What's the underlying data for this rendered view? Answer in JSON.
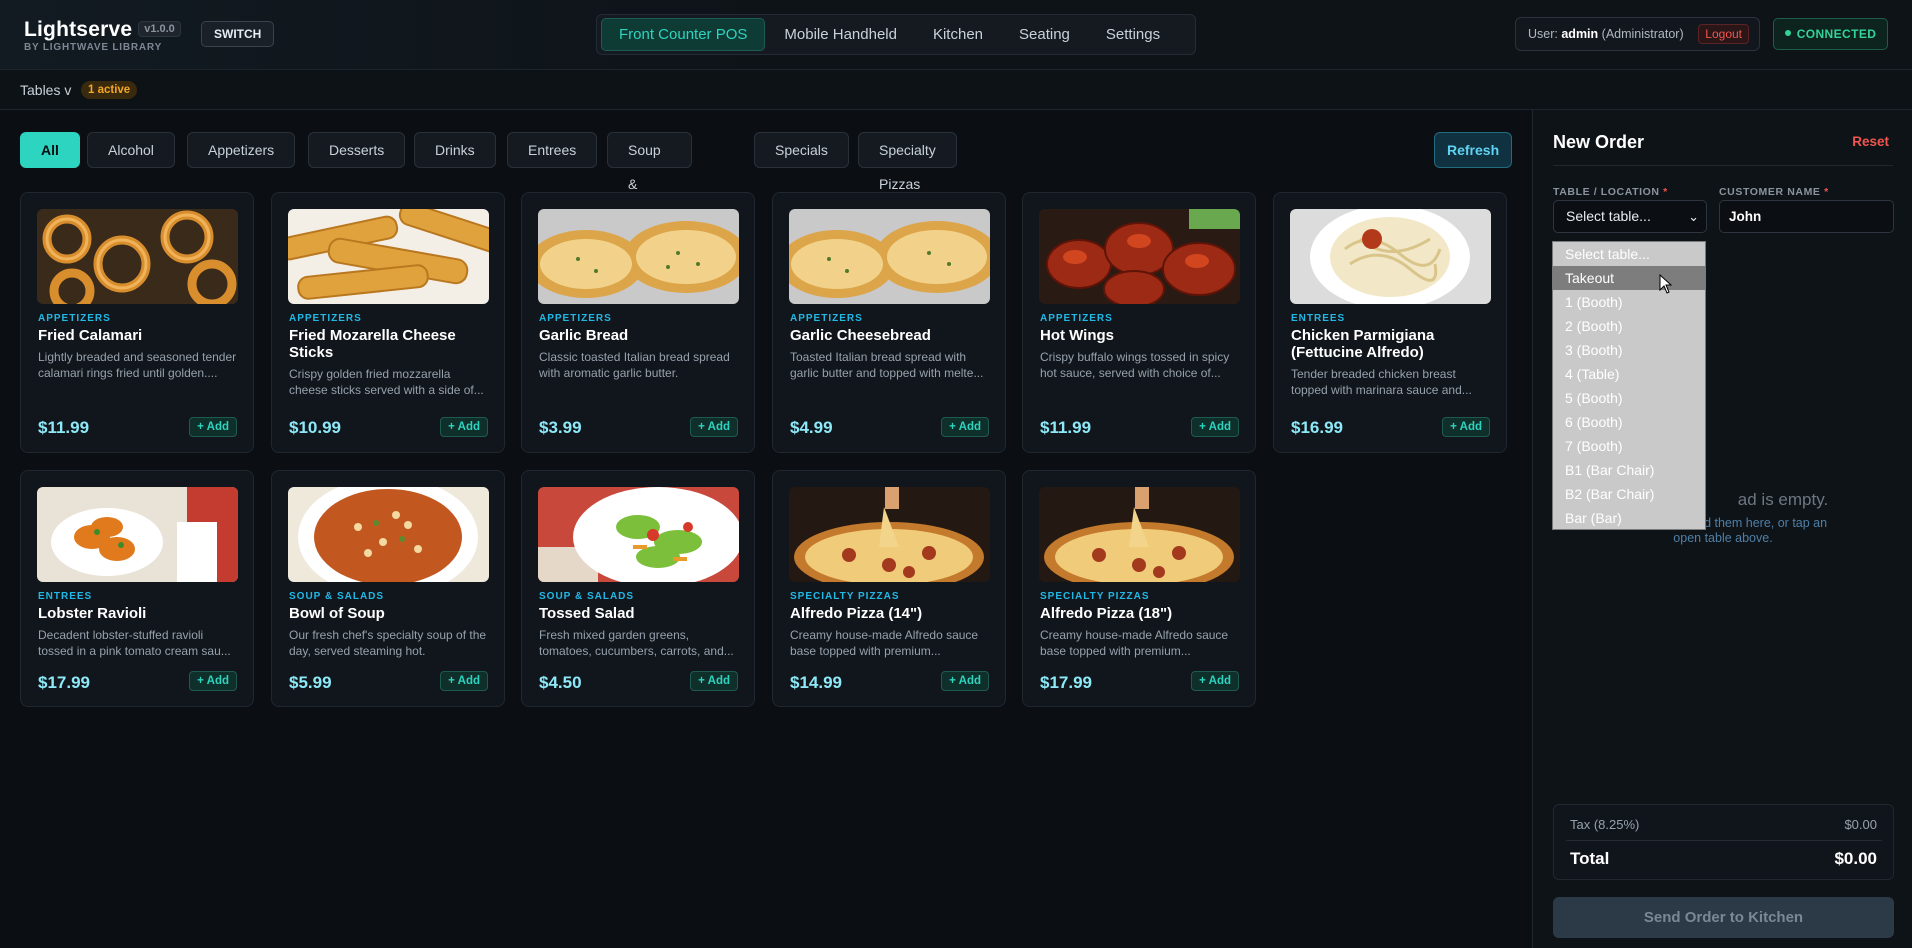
{
  "brand": {
    "name": "Lightserve",
    "version": "v1.0.0",
    "subtitle": "BY LIGHTWAVE LIBRARY",
    "switch_label": "SWITCH"
  },
  "nav": {
    "items": [
      {
        "label": "Front Counter POS",
        "active": true
      },
      {
        "label": "Mobile Handheld",
        "active": false
      },
      {
        "label": "Kitchen",
        "active": false
      },
      {
        "label": "Seating",
        "active": false
      },
      {
        "label": "Settings",
        "active": false
      }
    ]
  },
  "user": {
    "prefix": "User:",
    "name": "admin",
    "role": "(Administrator)",
    "logout_label": "Logout"
  },
  "connection": {
    "status": "CONNECTED",
    "color": "#34d399"
  },
  "subbar": {
    "tables_label": "Tables v",
    "active_badge": "1 active"
  },
  "filters": {
    "items": [
      "All",
      "Alcohol",
      "Appetizers",
      "Desserts",
      "Drinks",
      "Entrees",
      "Soup & Salads",
      "Specials",
      "Specialty Pizzas"
    ],
    "selected": "All",
    "refresh_label": "Refresh"
  },
  "products": [
    {
      "category": "APPETIZERS",
      "name": "Fried Calamari",
      "description": "Lightly breaded and seasoned tender calamari rings fried until golden....",
      "price": "$11.99",
      "add_label": "+ Add",
      "image": "calamari"
    },
    {
      "category": "APPETIZERS",
      "name": "Fried Mozarella Cheese Sticks",
      "description": "Crispy golden fried mozzarella cheese sticks served with a side of...",
      "price": "$10.99",
      "add_label": "+ Add",
      "image": "mozzarella-sticks"
    },
    {
      "category": "APPETIZERS",
      "name": "Garlic Bread",
      "description": "Classic toasted Italian bread spread with aromatic garlic butter.",
      "price": "$3.99",
      "add_label": "+ Add",
      "image": "garlic-bread"
    },
    {
      "category": "APPETIZERS",
      "name": "Garlic Cheesebread",
      "description": "Toasted Italian bread spread with garlic butter and topped with melte...",
      "price": "$4.99",
      "add_label": "+ Add",
      "image": "garlic-bread"
    },
    {
      "category": "APPETIZERS",
      "name": "Hot Wings",
      "description": "Crispy buffalo wings tossed in spicy hot sauce, served with choice of...",
      "price": "$11.99",
      "add_label": "+ Add",
      "image": "hot-wings"
    },
    {
      "category": "ENTREES",
      "name": "Chicken Parmigiana (Fettucine Alfredo)",
      "description": "Tender breaded chicken breast topped with marinara sauce and...",
      "price": "$16.99",
      "add_label": "+ Add",
      "image": "pasta-plate"
    },
    {
      "category": "ENTREES",
      "name": "Lobster Ravioli",
      "description": "Decadent lobster-stuffed ravioli tossed in a pink tomato cream sau...",
      "price": "$17.99",
      "add_label": "+ Add",
      "image": "ravioli"
    },
    {
      "category": "SOUP & SALADS",
      "name": "Bowl of Soup",
      "description": "Our fresh chef's specialty soup of the day, served steaming hot.",
      "price": "$5.99",
      "add_label": "+ Add",
      "image": "soup"
    },
    {
      "category": "SOUP & SALADS",
      "name": "Tossed Salad",
      "description": "Fresh mixed garden greens, tomatoes, cucumbers, carrots, and...",
      "price": "$4.50",
      "add_label": "+ Add",
      "image": "salad"
    },
    {
      "category": "SPECIALTY PIZZAS",
      "name": "Alfredo Pizza (14\")",
      "description": "Creamy house-made Alfredo sauce base topped with premium...",
      "price": "$14.99",
      "add_label": "+ Add",
      "image": "pizza"
    },
    {
      "category": "SPECIALTY PIZZAS",
      "name": "Alfredo Pizza (18\")",
      "description": "Creamy house-made Alfredo sauce base topped with premium...",
      "price": "$17.99",
      "add_label": "+ Add",
      "image": "pizza"
    }
  ],
  "order": {
    "title": "New Order",
    "reset_label": "Reset",
    "table_label": "TABLE / LOCATION",
    "customer_label": "CUSTOMER NAME",
    "required_mark": "*",
    "table_value": "Select table...",
    "customer_value": "John",
    "table_options": [
      "Select table...",
      "Takeout",
      "1 (Booth)",
      "2 (Booth)",
      "3 (Booth)",
      "4 (Table)",
      "5 (Booth)",
      "6 (Booth)",
      "7 (Booth)",
      "B1 (Bar Chair)",
      "B2 (Bar Chair)",
      "Bar (Bar)"
    ],
    "highlighted_option": "Takeout",
    "empty_title": "ad is empty.",
    "empty_sub_1": "eft to add them here, or tap an",
    "empty_sub_2": "open table above.",
    "tax_label": "Tax (8.25%)",
    "tax_value": "$0.00",
    "total_label": "Total",
    "total_value": "$0.00",
    "send_label": "Send Order to Kitchen"
  },
  "colors": {
    "accent": "#2dd4bf",
    "price": "#8de9f7",
    "category": "#22b8e6",
    "danger": "#f0564f",
    "warning": "#f5a524"
  }
}
